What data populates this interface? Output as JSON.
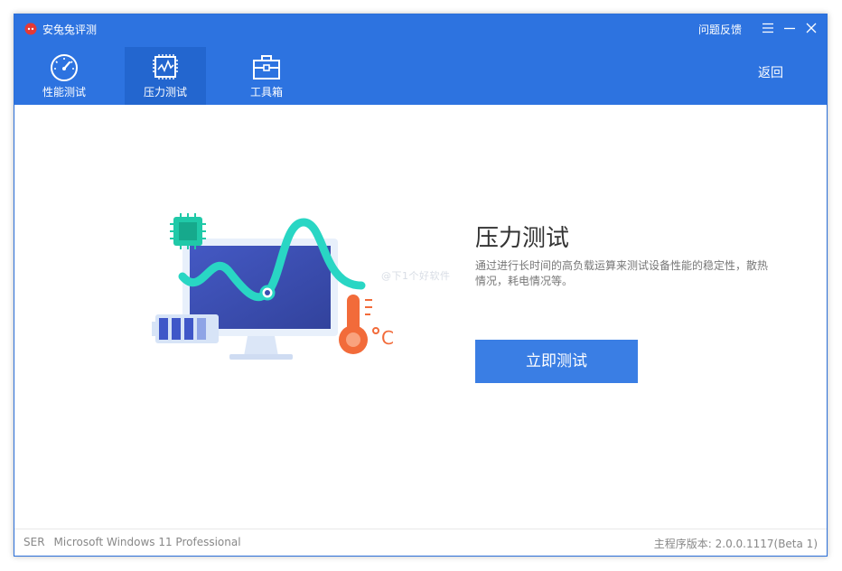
{
  "app": {
    "title": "安兔兔评测",
    "feedback_label": "问题反馈"
  },
  "nav": {
    "tabs": [
      {
        "label": "性能测试",
        "icon": "speedometer-icon",
        "active": false
      },
      {
        "label": "压力测试",
        "icon": "stress-chip-icon",
        "active": true
      },
      {
        "label": "工具箱",
        "icon": "toolbox-icon",
        "active": false
      }
    ],
    "back_label": "返回"
  },
  "main": {
    "title": "压力测试",
    "description": "通过进行长时间的高负载运算来测试设备性能的稳定性，散热情况，耗电情况等。",
    "start_button_label": "立即测试",
    "watermark": "@下1个好软件"
  },
  "status": {
    "device": "SER",
    "os": "Microsoft Windows 11 Professional",
    "version_text": "主程序版本: 2.0.0.1117(Beta 1)"
  },
  "colors": {
    "header": "#2d73e0",
    "active_tab": "#2366cf",
    "button": "#3a7ee4",
    "wave": "#29d6c4",
    "thermometer": "#f26b3a"
  }
}
